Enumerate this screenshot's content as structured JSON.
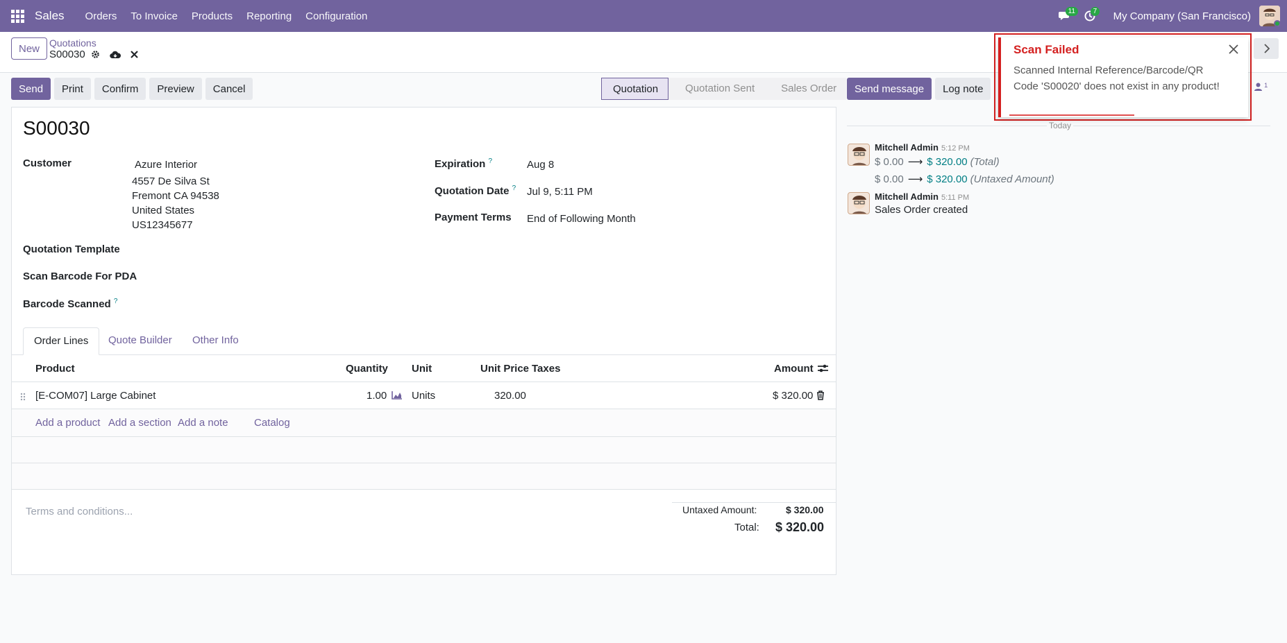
{
  "navbar": {
    "app_name": "Sales",
    "menu": [
      "Orders",
      "To Invoice",
      "Products",
      "Reporting",
      "Configuration"
    ],
    "messages_badge": "11",
    "activities_badge": "7",
    "company": "My Company (San Francisco)"
  },
  "breadcrumb": {
    "new_label": "New",
    "parent": "Quotations",
    "current": "S00030"
  },
  "actions": [
    "Send",
    "Print",
    "Confirm",
    "Preview",
    "Cancel"
  ],
  "statusbar": [
    "Quotation",
    "Quotation Sent",
    "Sales Order"
  ],
  "form": {
    "title": "S00030",
    "customer_label": "Customer",
    "customer_name": "Azure Interior",
    "address": [
      "4557 De Silva St",
      "Fremont CA 94538",
      "United States",
      "US12345677"
    ],
    "quotation_template_label": "Quotation Template",
    "scan_barcode_label": "Scan Barcode For PDA",
    "barcode_scanned_label": "Barcode Scanned",
    "expiration_label": "Expiration",
    "expiration_value": "Aug 8",
    "quotation_date_label": "Quotation Date",
    "quotation_date_value": "Jul 9, 5:11 PM",
    "payment_terms_label": "Payment Terms",
    "payment_terms_value": "End of Following Month",
    "help_mark": "?"
  },
  "tabs": [
    "Order Lines",
    "Quote Builder",
    "Other Info"
  ],
  "order_lines": {
    "headers": {
      "product": "Product",
      "quantity": "Quantity",
      "unit": "Unit",
      "unit_price": "Unit Price",
      "taxes": "Taxes",
      "amount": "Amount"
    },
    "rows": [
      {
        "product": "[E-COM07] Large Cabinet",
        "quantity": "1.00",
        "unit": "Units",
        "unit_price": "320.00",
        "taxes": "",
        "amount": "$ 320.00"
      }
    ],
    "add_links": [
      "Add a product",
      "Add a section",
      "Add a note",
      "Catalog"
    ]
  },
  "totals": {
    "terms_placeholder": "Terms and conditions...",
    "untaxed_label": "Untaxed Amount:",
    "untaxed_value": "$ 320.00",
    "total_label": "Total:",
    "total_value": "$ 320.00"
  },
  "chatter": {
    "send_message": "Send message",
    "log_note": "Log note",
    "followers_count": "1",
    "today": "Today",
    "messages": [
      {
        "author": "Mitchell Admin",
        "time": "5:12 PM",
        "changes": [
          {
            "old": "$ 0.00",
            "new": "$ 320.00",
            "field": "(Total)"
          },
          {
            "old": "$ 0.00",
            "new": "$ 320.00",
            "field": "(Untaxed Amount)"
          }
        ]
      },
      {
        "author": "Mitchell Admin",
        "time": "5:11 PM",
        "body": "Sales Order created"
      }
    ]
  },
  "notification": {
    "title": "Scan Failed",
    "body": "Scanned Internal Reference/Barcode/QR Code 'S00020' does not exist in any product!"
  },
  "colors": {
    "brand": "#71639e",
    "danger": "#d42020",
    "link_teal": "#017e84",
    "badge_green": "#28a745"
  }
}
